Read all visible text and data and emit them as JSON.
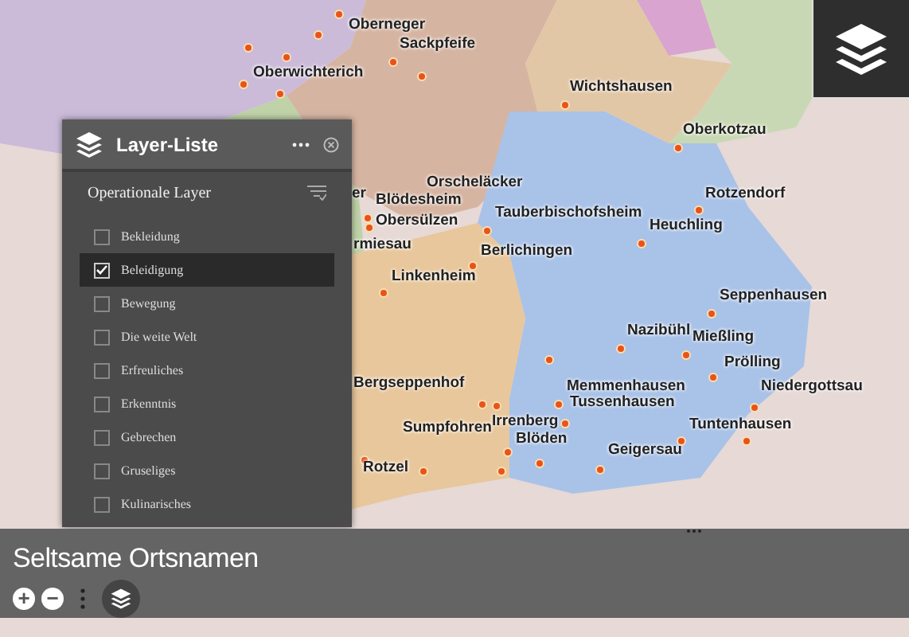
{
  "map": {
    "places": [
      "Oberneger",
      "Sackpfeife",
      "Oberwichterich",
      "Wichtshausen",
      "Oberkotzau",
      "Orscheläcker",
      "er",
      "Blödesheim",
      "Obersülzen",
      "Tauberbischofsheim",
      "Rotzendorf",
      "Heuchling",
      "rmiesau",
      "Berlichingen",
      "Linkenheim",
      "Seppenhausen",
      "Nazibühl",
      "Mießling",
      "Prölling",
      "Memmenhausen",
      "Niedergottsau",
      "Tussenhausen",
      "Tuntenhausen",
      "Geigersau",
      "Bergseppenhof",
      "Sumpfohren",
      "Irrenberg",
      "Blöden",
      "Rotzel"
    ]
  },
  "layer_panel": {
    "title": "Layer-Liste",
    "section": "Operationale Layer",
    "items": [
      {
        "label": "Bekleidung",
        "checked": false,
        "selected": false
      },
      {
        "label": "Beleidigung",
        "checked": true,
        "selected": true
      },
      {
        "label": "Bewegung",
        "checked": false,
        "selected": false
      },
      {
        "label": "Die weite Welt",
        "checked": false,
        "selected": false
      },
      {
        "label": "Erfreuliches",
        "checked": false,
        "selected": false
      },
      {
        "label": "Erkenntnis",
        "checked": false,
        "selected": false
      },
      {
        "label": "Gebrechen",
        "checked": false,
        "selected": false
      },
      {
        "label": "Gruseliges",
        "checked": false,
        "selected": false
      },
      {
        "label": "Kulinarisches",
        "checked": false,
        "selected": false
      }
    ]
  },
  "bottom_bar": {
    "title": "Seltsame Ortsnamen",
    "zoom_in": "+",
    "zoom_out": "−"
  }
}
